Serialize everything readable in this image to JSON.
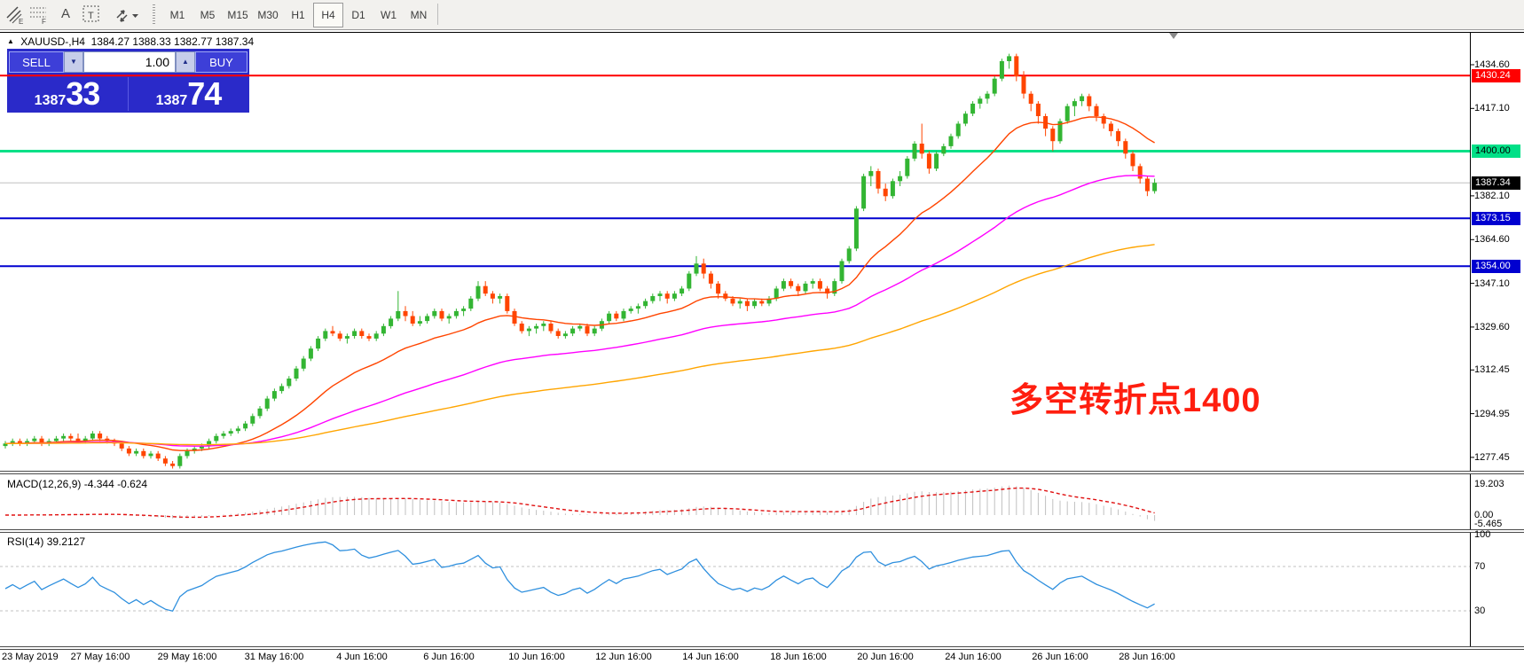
{
  "toolbar": {
    "icons": [
      {
        "name": "equidistant-channel-icon"
      },
      {
        "name": "fibonacci-grid-icon"
      },
      {
        "name": "text-label-icon",
        "glyph": "A"
      },
      {
        "name": "text-box-icon",
        "glyph": "T"
      },
      {
        "name": "arrow-tools-icon"
      }
    ],
    "timeframes": [
      {
        "label": "M1",
        "active": false
      },
      {
        "label": "M5",
        "active": false
      },
      {
        "label": "M15",
        "active": false
      },
      {
        "label": "M30",
        "active": false
      },
      {
        "label": "H1",
        "active": false
      },
      {
        "label": "H4",
        "active": true
      },
      {
        "label": "D1",
        "active": false
      },
      {
        "label": "W1",
        "active": false
      },
      {
        "label": "MN",
        "active": false
      }
    ]
  },
  "symbol_bar": {
    "collapse_icon": "▲",
    "symbol": "XAUUSD-,H4",
    "ohlc": "1384.27 1388.33 1382.77 1387.34"
  },
  "trade_panel": {
    "sell_label": "SELL",
    "buy_label": "BUY",
    "volume": "1.00",
    "sell_price_small": "1387",
    "sell_price_big": "33",
    "buy_price_small": "1387",
    "buy_price_big": "74"
  },
  "annotation": {
    "text": "多空转折点1400",
    "color": "#FF1E0F"
  },
  "chart_data": {
    "type": "candlestick",
    "symbol": "XAUUSD",
    "period": "H4",
    "y_axis": {
      "visible_min": 1271.4,
      "visible_max": 1447.0,
      "plain_labels": [
        {
          "text": "1434.60",
          "price": 1434.6
        },
        {
          "text": "1417.10",
          "price": 1417.1
        },
        {
          "text": "1382.10",
          "price": 1382.1
        },
        {
          "text": "1364.60",
          "price": 1364.6
        },
        {
          "text": "1347.10",
          "price": 1347.1
        },
        {
          "text": "1329.60",
          "price": 1329.6
        },
        {
          "text": "1312.45",
          "price": 1312.45
        },
        {
          "text": "1294.95",
          "price": 1294.95
        },
        {
          "text": "1277.45",
          "price": 1277.45
        }
      ]
    },
    "level_lines": [
      {
        "price": 1430.24,
        "label": "1430.24",
        "color": "#FF0000",
        "thickness": 2,
        "badge_bg": "#FF0000",
        "badge_fg": "#FFFFFF"
      },
      {
        "price": 1400.0,
        "label": "1400.00",
        "color": "#00E087",
        "thickness": 3,
        "badge_bg": "#00E087",
        "badge_fg": "#000000"
      },
      {
        "price": 1373.15,
        "label": "1373.15",
        "color": "#0000D0",
        "thickness": 2,
        "badge_bg": "#0000D0",
        "badge_fg": "#FFFFFF"
      },
      {
        "price": 1354.0,
        "label": "1354.00",
        "color": "#0000D0",
        "thickness": 2,
        "badge_bg": "#0000D0",
        "badge_fg": "#FFFFFF"
      }
    ],
    "current_price": {
      "price": 1387.34,
      "label": "1387.34",
      "line_color": "#C0C0C0",
      "badge_bg": "#000000",
      "badge_fg": "#FFFFFF"
    },
    "colors": {
      "bull": "#33B533",
      "bear": "#FF4500"
    },
    "moving_averages": [
      {
        "period": 20,
        "method": "ema",
        "color": "#FF4500"
      },
      {
        "period": 60,
        "method": "ema",
        "color": "#FF00FF"
      },
      {
        "period": 130,
        "method": "ema",
        "color": "#FFA500"
      }
    ],
    "x_labels": [
      {
        "text": "23 May 2019",
        "bar": 0,
        "align": "left"
      },
      {
        "text": "27 May 16:00",
        "bar": 13
      },
      {
        "text": "29 May 16:00",
        "bar": 25
      },
      {
        "text": "31 May 16:00",
        "bar": 37
      },
      {
        "text": "4 Jun 16:00",
        "bar": 49
      },
      {
        "text": "6 Jun 16:00",
        "bar": 61
      },
      {
        "text": "10 Jun 16:00",
        "bar": 73
      },
      {
        "text": "12 Jun 16:00",
        "bar": 85
      },
      {
        "text": "14 Jun 16:00",
        "bar": 97
      },
      {
        "text": "18 Jun 16:00",
        "bar": 109
      },
      {
        "text": "20 Jun 16:00",
        "bar": 121
      },
      {
        "text": "24 Jun 16:00",
        "bar": 133
      },
      {
        "text": "26 Jun 16:00",
        "bar": 145
      },
      {
        "text": "28 Jun 16:00",
        "bar": 157
      }
    ],
    "macd": {
      "title": "MACD(12,26,9)",
      "current": "-4.344 -0.624",
      "fast": 12,
      "slow": 26,
      "signal": 9,
      "axis_labels": [
        {
          "text": "19.203",
          "value": 19.203
        },
        {
          "text": "0.00",
          "value": 0
        },
        {
          "text": "-5.465",
          "value": -5.465
        }
      ],
      "hist_color": "#C0C0C0",
      "signal_color": "#E01010"
    },
    "rsi": {
      "title": "RSI(14)",
      "current": "39.2127",
      "period": 14,
      "axis_labels": [
        {
          "text": "100",
          "value": 100
        },
        {
          "text": "70",
          "value": 70
        },
        {
          "text": "30",
          "value": 30
        }
      ],
      "levels": [
        70,
        30
      ],
      "line_color": "#2E8FDE",
      "level_color": "#C0C0C0"
    },
    "candles": [
      [
        1282,
        1284,
        1281,
        1283
      ],
      [
        1283,
        1285,
        1282,
        1284
      ],
      [
        1284,
        1285,
        1282,
        1283
      ],
      [
        1283,
        1285,
        1282,
        1284
      ],
      [
        1284,
        1286,
        1283,
        1285
      ],
      [
        1285,
        1286,
        1282,
        1283
      ],
      [
        1283,
        1285,
        1282,
        1284
      ],
      [
        1284,
        1286,
        1283,
        1285
      ],
      [
        1285,
        1287,
        1284,
        1286
      ],
      [
        1286,
        1287,
        1284,
        1285
      ],
      [
        1285,
        1287,
        1283,
        1284
      ],
      [
        1284,
        1286,
        1283,
        1285
      ],
      [
        1285,
        1288,
        1284,
        1287
      ],
      [
        1287,
        1288,
        1284,
        1285
      ],
      [
        1285,
        1286,
        1283,
        1284
      ],
      [
        1284,
        1285,
        1282,
        1283
      ],
      [
        1283,
        1284,
        1280,
        1281
      ],
      [
        1281,
        1282,
        1278,
        1279
      ],
      [
        1279,
        1281,
        1278,
        1280
      ],
      [
        1280,
        1281,
        1277,
        1278
      ],
      [
        1278,
        1280,
        1277,
        1279
      ],
      [
        1279,
        1280,
        1276,
        1277
      ],
      [
        1277,
        1278,
        1274,
        1275
      ],
      [
        1275,
        1276,
        1273,
        1274
      ],
      [
        1274,
        1279,
        1273,
        1278
      ],
      [
        1278,
        1281,
        1277,
        1280
      ],
      [
        1280,
        1282,
        1279,
        1281
      ],
      [
        1281,
        1283,
        1280,
        1282
      ],
      [
        1282,
        1285,
        1281,
        1284
      ],
      [
        1284,
        1287,
        1283,
        1286
      ],
      [
        1286,
        1288,
        1285,
        1287
      ],
      [
        1287,
        1289,
        1286,
        1288
      ],
      [
        1288,
        1290,
        1287,
        1289
      ],
      [
        1289,
        1292,
        1288,
        1291
      ],
      [
        1291,
        1295,
        1290,
        1294
      ],
      [
        1294,
        1298,
        1293,
        1297
      ],
      [
        1297,
        1302,
        1296,
        1301
      ],
      [
        1301,
        1305,
        1300,
        1304
      ],
      [
        1304,
        1307,
        1303,
        1306
      ],
      [
        1306,
        1310,
        1305,
        1309
      ],
      [
        1309,
        1314,
        1308,
        1313
      ],
      [
        1313,
        1318,
        1312,
        1317
      ],
      [
        1317,
        1322,
        1316,
        1321
      ],
      [
        1321,
        1326,
        1320,
        1325
      ],
      [
        1325,
        1329,
        1324,
        1328
      ],
      [
        1328,
        1330,
        1326,
        1327
      ],
      [
        1327,
        1328,
        1324,
        1325
      ],
      [
        1325,
        1327,
        1323,
        1326
      ],
      [
        1326,
        1329,
        1325,
        1328
      ],
      [
        1328,
        1329,
        1325,
        1326
      ],
      [
        1326,
        1327,
        1324,
        1325
      ],
      [
        1325,
        1328,
        1324,
        1327
      ],
      [
        1327,
        1331,
        1326,
        1330
      ],
      [
        1330,
        1334,
        1329,
        1333
      ],
      [
        1333,
        1344,
        1332,
        1336
      ],
      [
        1336,
        1338,
        1332,
        1334
      ],
      [
        1334,
        1336,
        1330,
        1331
      ],
      [
        1331,
        1334,
        1330,
        1332
      ],
      [
        1332,
        1335,
        1331,
        1334
      ],
      [
        1334,
        1337,
        1333,
        1336
      ],
      [
        1336,
        1337,
        1332,
        1333
      ],
      [
        1333,
        1335,
        1331,
        1334
      ],
      [
        1334,
        1337,
        1333,
        1336
      ],
      [
        1336,
        1338,
        1334,
        1337
      ],
      [
        1337,
        1342,
        1336,
        1341
      ],
      [
        1341,
        1348,
        1340,
        1346
      ],
      [
        1346,
        1348,
        1342,
        1343
      ],
      [
        1343,
        1344,
        1339,
        1341
      ],
      [
        1341,
        1343,
        1339,
        1342
      ],
      [
        1342,
        1343,
        1335,
        1336
      ],
      [
        1336,
        1337,
        1330,
        1331
      ],
      [
        1331,
        1332,
        1327,
        1328
      ],
      [
        1328,
        1330,
        1326,
        1329
      ],
      [
        1329,
        1331,
        1327,
        1330
      ],
      [
        1330,
        1332,
        1328,
        1331
      ],
      [
        1331,
        1332,
        1327,
        1328
      ],
      [
        1328,
        1329,
        1325,
        1326
      ],
      [
        1326,
        1328,
        1325,
        1327
      ],
      [
        1327,
        1330,
        1326,
        1329
      ],
      [
        1329,
        1331,
        1328,
        1330
      ],
      [
        1330,
        1331,
        1326,
        1327
      ],
      [
        1327,
        1330,
        1326,
        1329
      ],
      [
        1329,
        1333,
        1328,
        1332
      ],
      [
        1332,
        1336,
        1331,
        1335
      ],
      [
        1335,
        1336,
        1332,
        1333
      ],
      [
        1333,
        1337,
        1332,
        1336
      ],
      [
        1336,
        1338,
        1335,
        1337
      ],
      [
        1337,
        1339,
        1335,
        1338
      ],
      [
        1338,
        1341,
        1337,
        1340
      ],
      [
        1340,
        1343,
        1339,
        1342
      ],
      [
        1342,
        1344,
        1340,
        1343
      ],
      [
        1343,
        1344,
        1339,
        1341
      ],
      [
        1341,
        1344,
        1340,
        1343
      ],
      [
        1343,
        1346,
        1342,
        1345
      ],
      [
        1345,
        1352,
        1344,
        1351
      ],
      [
        1351,
        1358,
        1350,
        1355
      ],
      [
        1355,
        1357,
        1349,
        1351
      ],
      [
        1351,
        1352,
        1345,
        1347
      ],
      [
        1347,
        1348,
        1341,
        1343
      ],
      [
        1343,
        1344,
        1340,
        1341
      ],
      [
        1341,
        1342,
        1338,
        1339
      ],
      [
        1339,
        1341,
        1337,
        1340
      ],
      [
        1340,
        1341,
        1336,
        1338
      ],
      [
        1338,
        1341,
        1337,
        1340
      ],
      [
        1340,
        1341,
        1338,
        1339
      ],
      [
        1339,
        1342,
        1338,
        1341
      ],
      [
        1341,
        1346,
        1340,
        1345
      ],
      [
        1345,
        1349,
        1344,
        1348
      ],
      [
        1348,
        1349,
        1345,
        1346
      ],
      [
        1346,
        1347,
        1342,
        1344
      ],
      [
        1344,
        1348,
        1343,
        1347
      ],
      [
        1347,
        1349,
        1345,
        1348
      ],
      [
        1348,
        1349,
        1344,
        1345
      ],
      [
        1345,
        1346,
        1341,
        1343
      ],
      [
        1343,
        1349,
        1342,
        1348
      ],
      [
        1348,
        1357,
        1347,
        1356
      ],
      [
        1356,
        1362,
        1355,
        1361
      ],
      [
        1361,
        1378,
        1360,
        1377
      ],
      [
        1377,
        1391,
        1376,
        1390
      ],
      [
        1390,
        1394,
        1386,
        1392
      ],
      [
        1392,
        1393,
        1383,
        1385
      ],
      [
        1385,
        1387,
        1380,
        1382
      ],
      [
        1382,
        1389,
        1381,
        1388
      ],
      [
        1388,
        1392,
        1386,
        1390
      ],
      [
        1390,
        1398,
        1389,
        1397
      ],
      [
        1397,
        1404,
        1396,
        1403
      ],
      [
        1403,
        1411,
        1397,
        1399
      ],
      [
        1399,
        1400,
        1391,
        1393
      ],
      [
        1393,
        1400,
        1392,
        1399
      ],
      [
        1399,
        1403,
        1398,
        1402
      ],
      [
        1402,
        1407,
        1401,
        1406
      ],
      [
        1406,
        1412,
        1405,
        1411
      ],
      [
        1411,
        1416,
        1410,
        1415
      ],
      [
        1415,
        1420,
        1414,
        1419
      ],
      [
        1419,
        1422,
        1417,
        1421
      ],
      [
        1421,
        1424,
        1419,
        1423
      ],
      [
        1423,
        1430,
        1422,
        1429
      ],
      [
        1429,
        1437,
        1428,
        1436
      ],
      [
        1436,
        1439,
        1433,
        1438
      ],
      [
        1438,
        1439,
        1428,
        1430
      ],
      [
        1430,
        1432,
        1421,
        1423
      ],
      [
        1423,
        1424,
        1416,
        1419
      ],
      [
        1419,
        1420,
        1411,
        1414
      ],
      [
        1414,
        1415,
        1406,
        1409
      ],
      [
        1409,
        1410,
        1400,
        1404
      ],
      [
        1404,
        1413,
        1403,
        1412
      ],
      [
        1412,
        1419,
        1411,
        1418
      ],
      [
        1418,
        1421,
        1414,
        1420
      ],
      [
        1420,
        1423,
        1418,
        1422
      ],
      [
        1422,
        1423,
        1416,
        1418
      ],
      [
        1418,
        1419,
        1412,
        1414
      ],
      [
        1414,
        1415,
        1409,
        1411
      ],
      [
        1411,
        1412,
        1406,
        1408
      ],
      [
        1408,
        1409,
        1402,
        1404
      ],
      [
        1404,
        1405,
        1397,
        1399
      ],
      [
        1399,
        1400,
        1392,
        1394
      ],
      [
        1394,
        1395,
        1387,
        1389
      ],
      [
        1389,
        1390,
        1382,
        1384
      ],
      [
        1384,
        1389,
        1383,
        1387.34
      ]
    ]
  }
}
